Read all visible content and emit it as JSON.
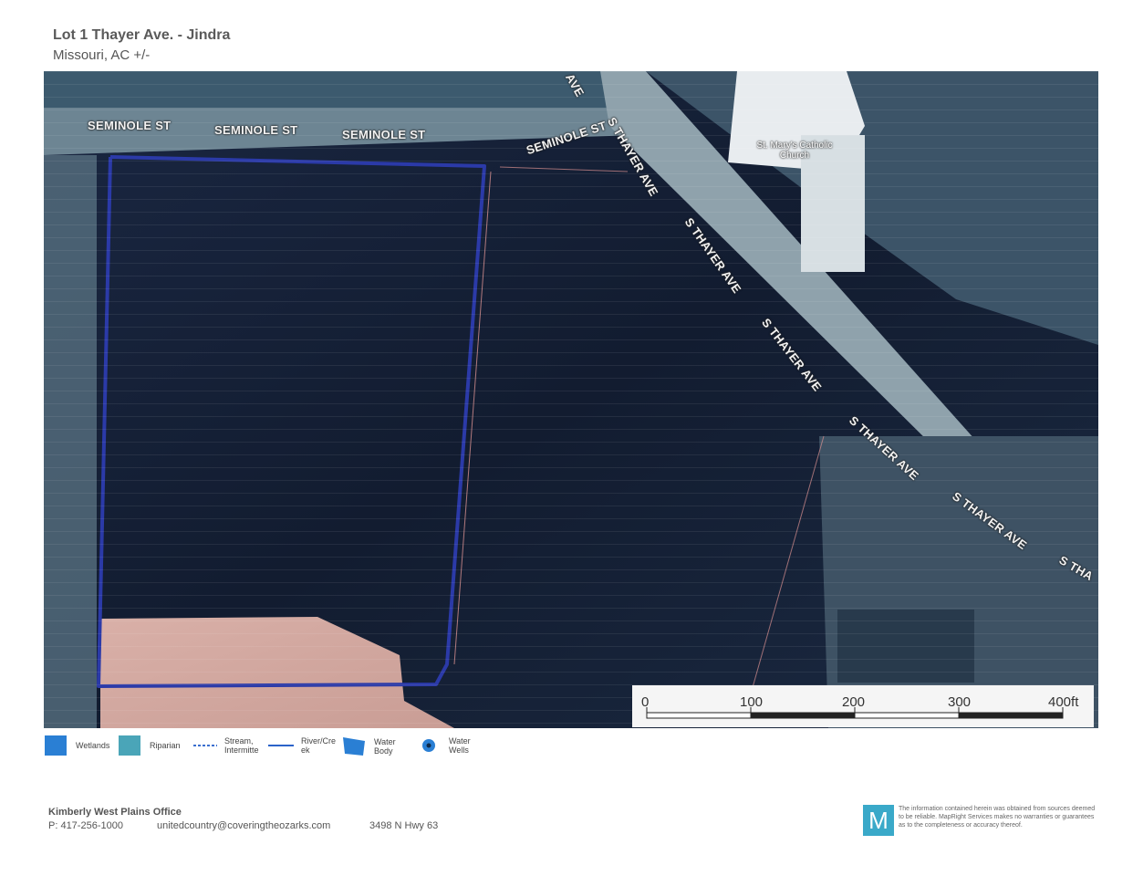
{
  "header": {
    "title": "Lot 1 Thayer Ave. - Jindra",
    "subtitle": "Missouri,  AC +/-"
  },
  "map": {
    "streets": {
      "seminole": [
        "SEMINOLE ST",
        "SEMINOLE ST",
        "SEMINOLE ST",
        "SEMINOLE ST"
      ],
      "thayer": [
        "S THAYER AVE",
        "S THAYER AVE",
        "S THAYER AVE",
        "S THAYER AVE",
        "S THAYER AVE",
        "S THA",
        "AVE"
      ]
    },
    "landmark": "St. Mary's Catholic Church",
    "boundary_color": "#2b3aa8"
  },
  "scale": {
    "labels": [
      "0",
      "100",
      "200",
      "300",
      "400ft"
    ]
  },
  "legend": [
    {
      "label": "Wetlands",
      "icon": "wetlands-swatch",
      "color": "#2a7fd4"
    },
    {
      "label": "Riparian",
      "icon": "riparian-swatch",
      "color": "#4aa5b8"
    },
    {
      "label": "Stream, Intermitte",
      "icon": "stream-dashed-line",
      "color": "#3b6fcf"
    },
    {
      "label": "River/Cre ek",
      "icon": "river-line",
      "color": "#2b63c9"
    },
    {
      "label": "Water Body",
      "icon": "water-body-shape",
      "color": "#2a7fd4"
    },
    {
      "label": "Water Wells",
      "icon": "water-well-marker",
      "color": "#2a7fd4"
    }
  ],
  "footer": {
    "office": "Kimberly West Plains Office",
    "phone": "P: 417-256-1000",
    "email": "unitedcountry@coveringtheozarks.com",
    "address": "3498 N Hwy 63",
    "logo_letter": "M",
    "disclaimer": "The information contained herein was obtained from sources deemed to be reliable. MapRight Services makes no warranties or guarantees as to the completeness or accuracy thereof."
  }
}
